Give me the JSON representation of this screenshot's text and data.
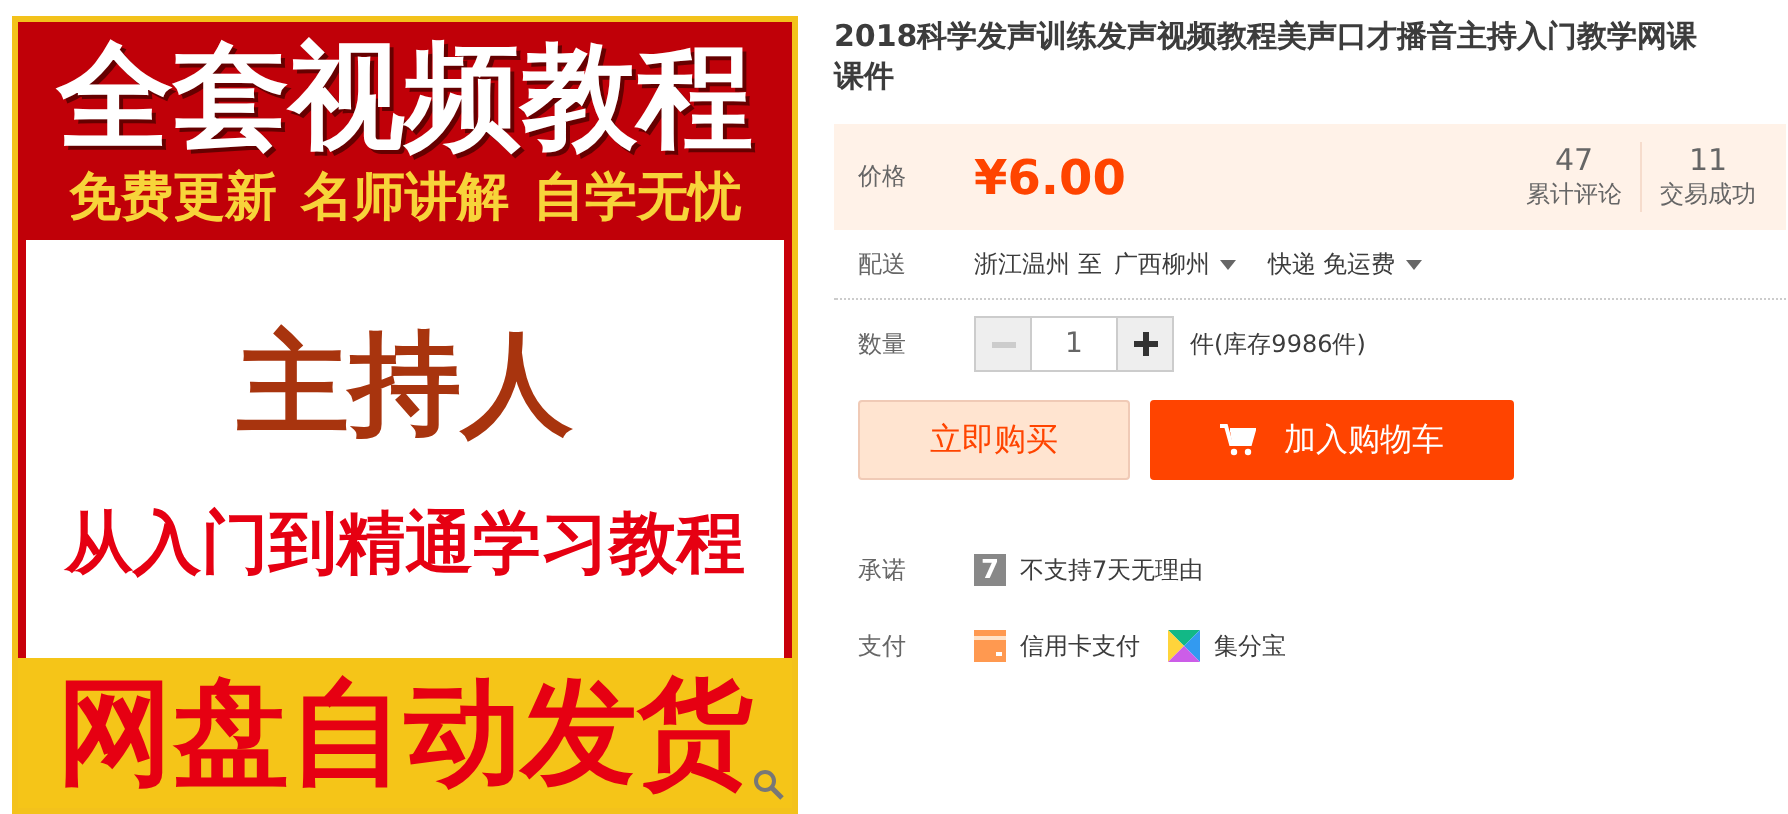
{
  "product_image": {
    "headline": "全套视频教程",
    "features": [
      "免费更新",
      "名师讲解",
      "自学无忧"
    ],
    "subject": "主持人",
    "tagline": "从入门到精通学习教程",
    "footer": "网盘自动发货"
  },
  "title": "2018科学发声训练发声视频教程美声口才播音主持入门教学网课课件",
  "price": {
    "label": "价格",
    "currency": "¥",
    "amount": "6.00",
    "stats": [
      {
        "value": "47",
        "label": "累计评论"
      },
      {
        "value": "11",
        "label": "交易成功"
      }
    ]
  },
  "delivery": {
    "label": "配送",
    "origin": "浙江温州 至",
    "destination": "广西柳州",
    "shipping": "快递 免运费"
  },
  "quantity": {
    "label": "数量",
    "value": "1",
    "stock": "件(库存9986件)"
  },
  "buttons": [
    {
      "kind": "buy",
      "label": "立即购买"
    },
    {
      "kind": "cart",
      "label": "加入购物车"
    }
  ],
  "promise": {
    "label": "承诺",
    "items": [
      {
        "kind": "badge",
        "badge": "7",
        "text": "不支持7天无理由"
      }
    ]
  },
  "payment": {
    "label": "支付",
    "methods": [
      {
        "kind": "card",
        "text": "信用卡支付"
      },
      {
        "kind": "points",
        "text": "集分宝"
      }
    ]
  }
}
